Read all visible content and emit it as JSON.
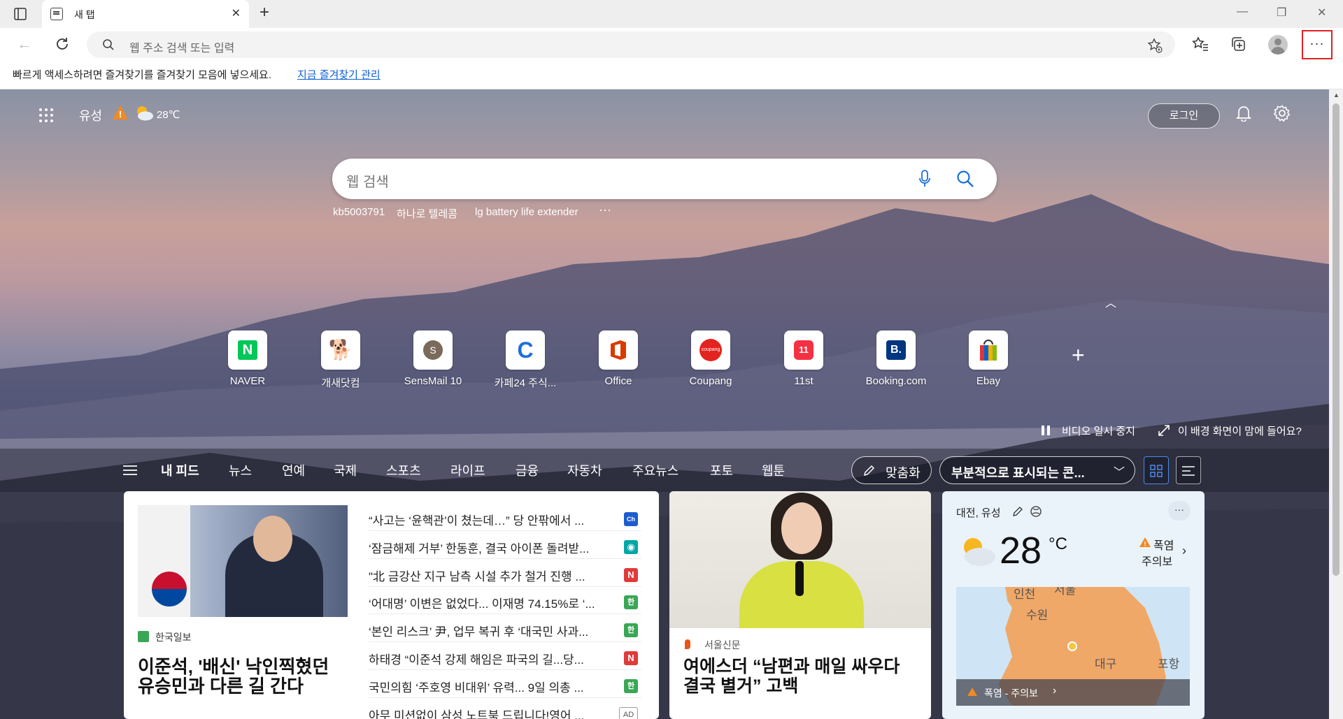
{
  "browser": {
    "tab_title": "새 탭",
    "address_placeholder": "웹 주소 검색 또는 입력",
    "favorites_prompt": "빠르게 액세스하려면 즐겨찾기를 즐겨찾기 모음에 넣으세요.",
    "favorites_manage_link": "지금 즐겨찾기 관리",
    "menu_icon_glyph": "···"
  },
  "header": {
    "location": "유성",
    "weather_temp": "28℃",
    "login_label": "로그인"
  },
  "search": {
    "placeholder": "웹 검색",
    "suggestions": [
      "kb5003791",
      "하나로 텔레콤",
      "lg battery life extender"
    ],
    "more": "···"
  },
  "quick_links": [
    {
      "label": "NAVER",
      "glyph": "N",
      "color": "#03c75a"
    },
    {
      "label": "개새닷컴",
      "glyph": "🐕",
      "color": "#e8a23b"
    },
    {
      "label": "SensMail 10",
      "glyph": "S",
      "color": "#7a6a5c"
    },
    {
      "label": "카페24 주식...",
      "glyph": "C",
      "color": "#1e6fd9"
    },
    {
      "label": "Office",
      "glyph": "O",
      "color": "#d83b01"
    },
    {
      "label": "Coupang",
      "glyph": "coupang",
      "color": "#e3231f"
    },
    {
      "label": "11st",
      "glyph": "11",
      "color": "#f43142"
    },
    {
      "label": "Booking.com",
      "glyph": "B.",
      "color": "#003580"
    },
    {
      "label": "Ebay",
      "glyph": "▮",
      "color": "#0064d2"
    }
  ],
  "background_controls": {
    "pause_video": "비디오 일시 중지",
    "like_background": "이 배경 화면이 맘에 들어요?"
  },
  "feed_nav": {
    "items": [
      "내 피드",
      "뉴스",
      "연예",
      "국제",
      "스포츠",
      "라이프",
      "금융",
      "자동차",
      "주요뉴스",
      "포토",
      "웹툰"
    ],
    "customize": "맞춤화",
    "display_mode": "부분적으로 표시되는 콘..."
  },
  "main_story": {
    "source": "한국일보",
    "headline_line1": "이준석, '배신' 낙인찍혔던",
    "headline_line2": "유승민과 다른 길 간다"
  },
  "news_list": [
    {
      "text": "“사고는 ‘윤핵관’이 쳤는데…” 당 안팎에서 ...",
      "badge": "Ch",
      "color": "#1d5ccf"
    },
    {
      "text": "‘잠금해제 거부’ 한동훈, 결국 아이폰 돌려받...",
      "badge": "◉",
      "color": "#00a6a6"
    },
    {
      "text": "\"北 금강산 지구 남측 시설 추가 철거 진행 ...",
      "badge": "N",
      "color": "#e03a3a"
    },
    {
      "text": "‘어대명’ 이변은 없었다... 이재명 74.15%로 ‘...",
      "badge": "한",
      "color": "#3aa655"
    },
    {
      "text": "‘본인 리스크’ 尹, 업무 복귀 후 ‘대국민 사과...",
      "badge": "한",
      "color": "#3aa655"
    },
    {
      "text": "하태경 “이준석 강제 해임은 파국의 길...당...",
      "badge": "N",
      "color": "#e03a3a"
    },
    {
      "text": "국민의힘 ‘주호영 비대위’ 유력... 9일 의총 ...",
      "badge": "한",
      "color": "#3aa655"
    },
    {
      "text": "아무 미션없이 삼성 노트북 드립니다!영어 ...",
      "badge": "AD",
      "color": "#ffffff"
    }
  ],
  "story2": {
    "source": "서울신문",
    "headline_line1": "여에스더 “남편과 매일 싸우다",
    "headline_line2": "결국 별거” 고백"
  },
  "weather": {
    "location": "대전, 유성",
    "temp": "28",
    "unit": "°C",
    "alert_line1": "폭염",
    "alert_line2": "주의보",
    "map_labels": [
      "인천",
      "서울",
      "수원",
      "대구",
      "포항"
    ],
    "map_alert": "폭염 - 주의보"
  }
}
